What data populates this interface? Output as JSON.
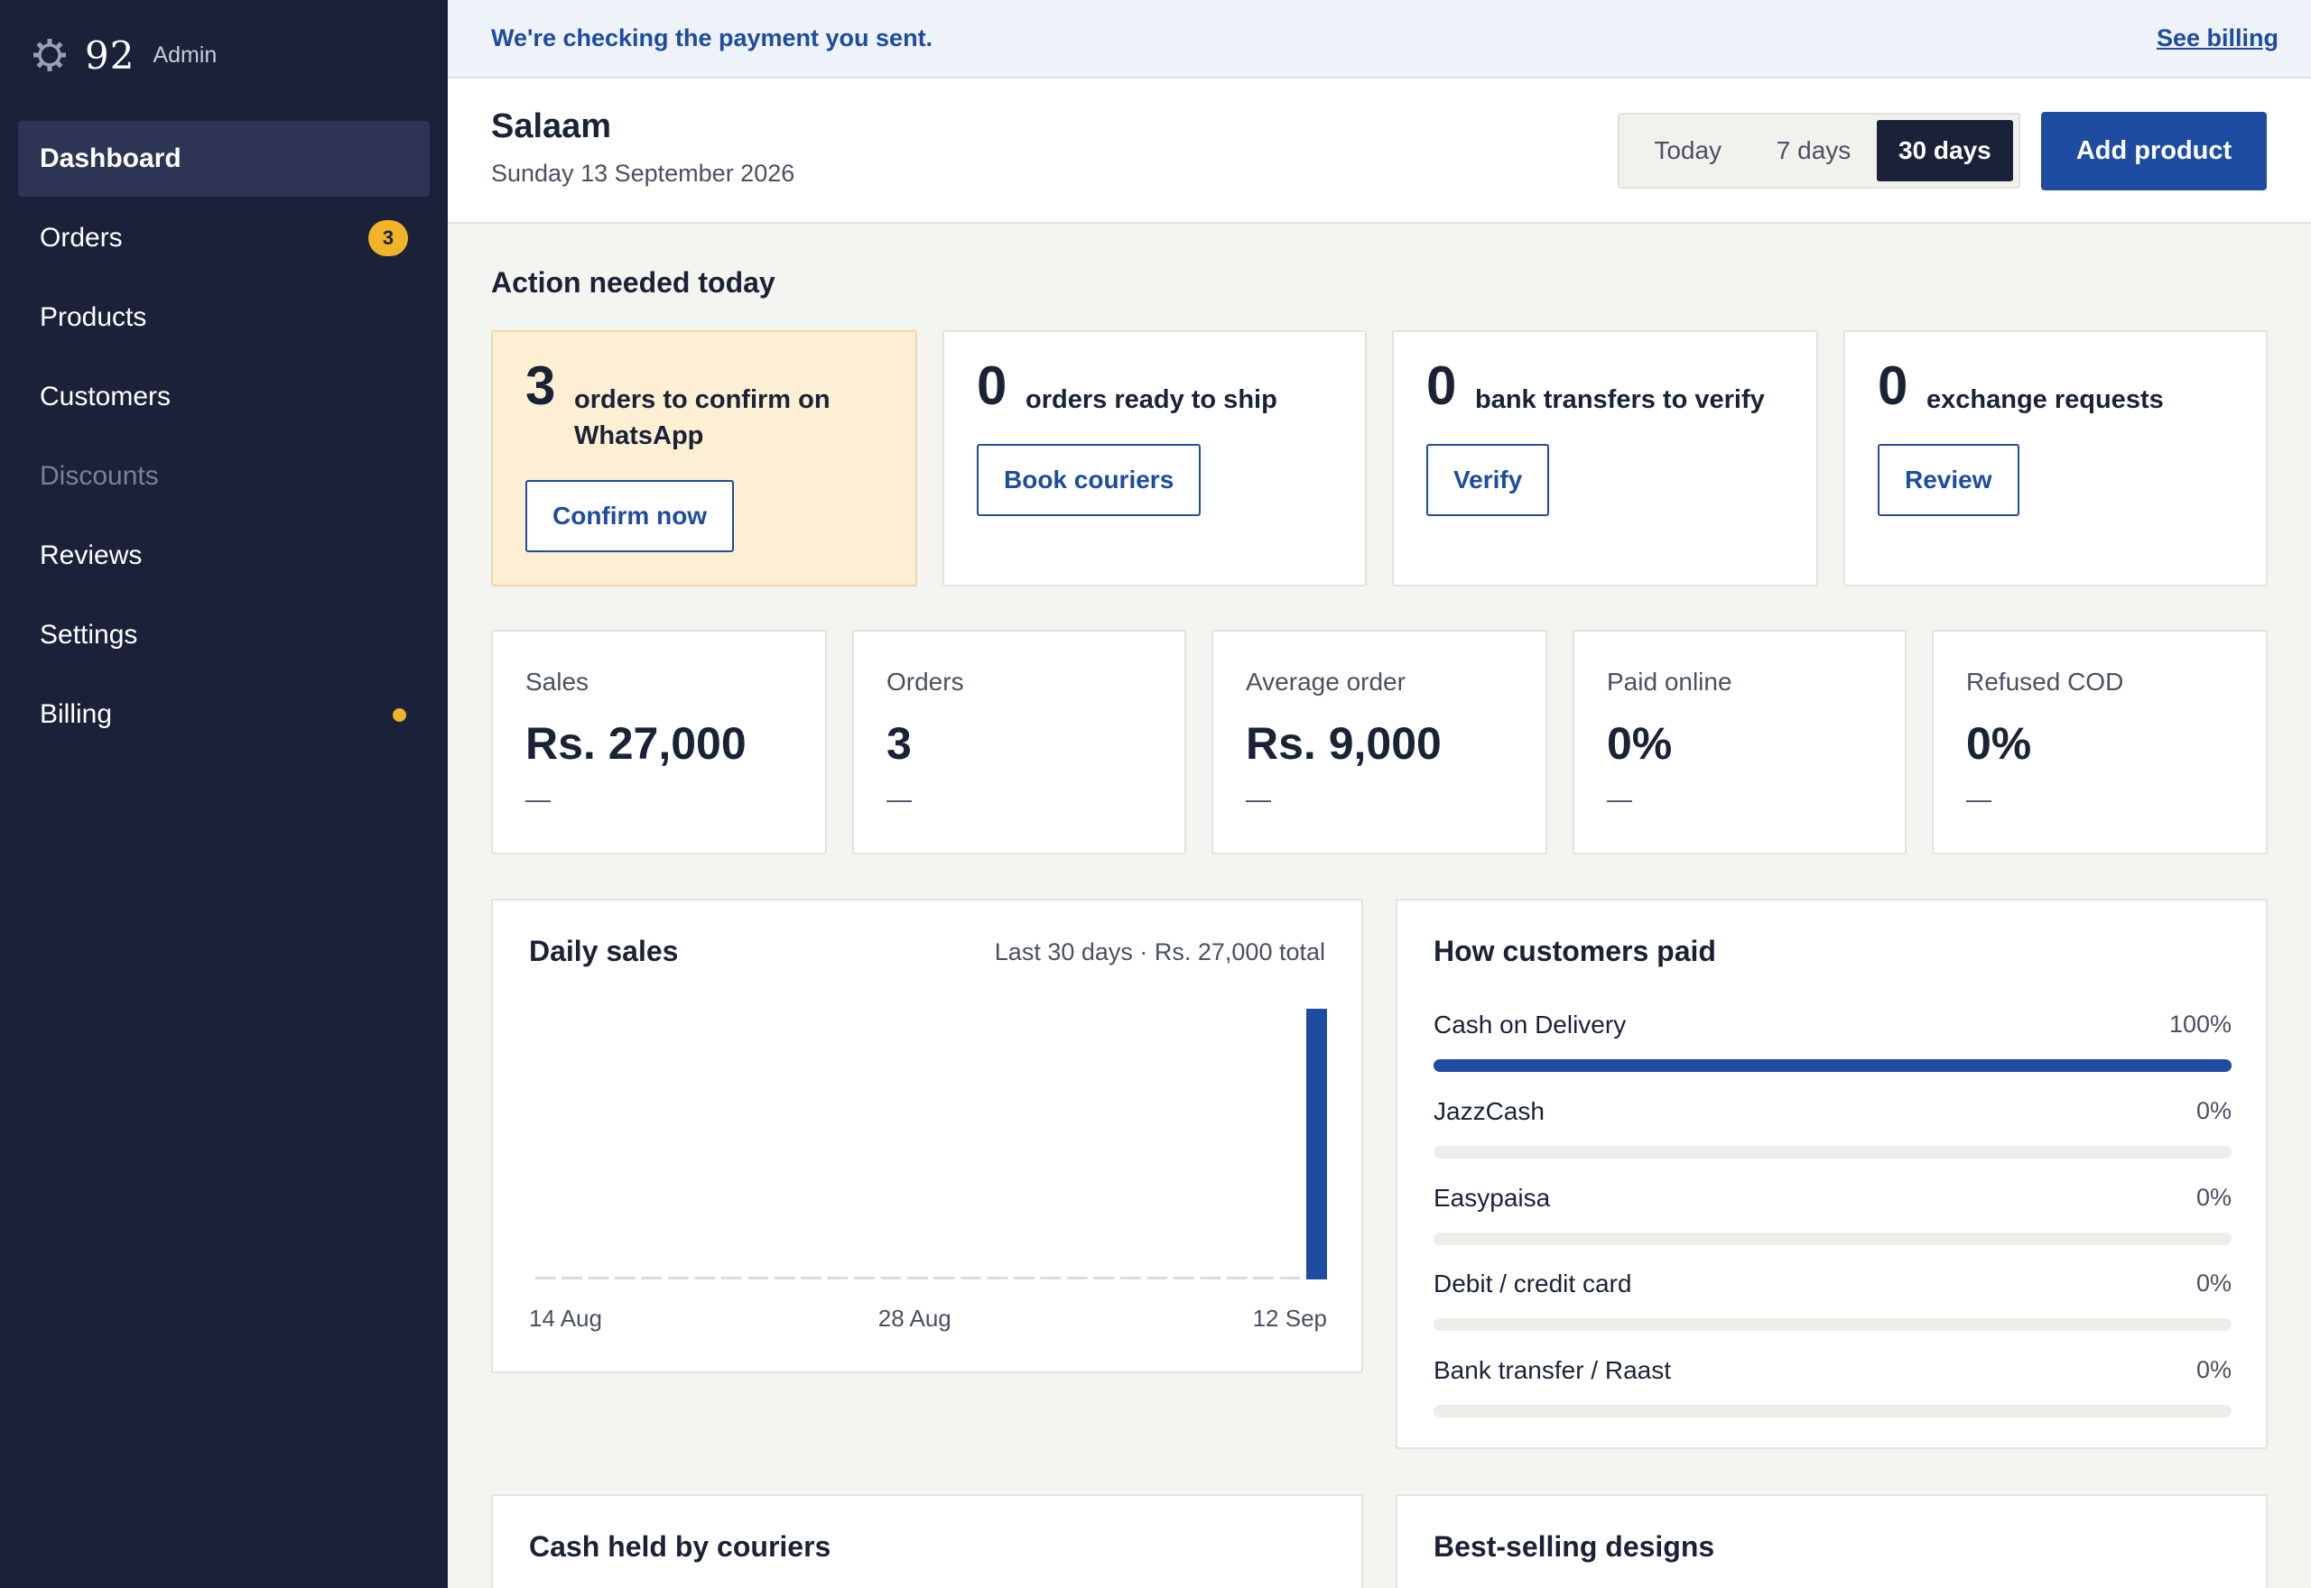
{
  "brand": {
    "logo": "92",
    "admin_label": "Admin"
  },
  "sidebar": {
    "items": [
      {
        "label": "Dashboard",
        "state": "active"
      },
      {
        "label": "Orders",
        "badge": "3"
      },
      {
        "label": "Products"
      },
      {
        "label": "Customers"
      },
      {
        "label": "Discounts",
        "state": "disabled"
      },
      {
        "label": "Reviews"
      },
      {
        "label": "Settings"
      },
      {
        "label": "Billing",
        "dot": true
      }
    ]
  },
  "notice": {
    "message": "We're checking the payment you sent.",
    "link": "See billing"
  },
  "header": {
    "greeting": "Salaam",
    "date": "Sunday 13 September 2026",
    "range": [
      "Today",
      "7 days",
      "30 days"
    ],
    "range_selected": "30 days",
    "add_product": "Add product"
  },
  "action_needed": {
    "title": "Action needed today",
    "cards": [
      {
        "count": "3",
        "text": "orders to confirm on WhatsApp",
        "button": "Confirm now"
      },
      {
        "count": "0",
        "text": "orders ready to ship",
        "button": "Book couriers"
      },
      {
        "count": "0",
        "text": "bank transfers to verify",
        "button": "Verify"
      },
      {
        "count": "0",
        "text": "exchange requests",
        "button": "Review"
      }
    ]
  },
  "stats": [
    {
      "label": "Sales",
      "value": "Rs. 27,000",
      "delta": "—"
    },
    {
      "label": "Orders",
      "value": "3",
      "delta": "—"
    },
    {
      "label": "Average order",
      "value": "Rs. 9,000",
      "delta": "—"
    },
    {
      "label": "Paid online",
      "value": "0%",
      "delta": "—"
    },
    {
      "label": "Refused COD",
      "value": "0%",
      "delta": "—"
    }
  ],
  "daily_sales": {
    "title": "Daily sales",
    "subtitle": "Last 30 days · Rs. 27,000 total",
    "x_tick_labels": [
      "14 Aug",
      "28 Aug",
      "12 Sep"
    ]
  },
  "chart_data": {
    "type": "bar",
    "title": "Daily sales",
    "x_start": "14 Aug",
    "x_end": "12 Sep",
    "values": [
      0,
      0,
      0,
      0,
      0,
      0,
      0,
      0,
      0,
      0,
      0,
      0,
      0,
      0,
      0,
      0,
      0,
      0,
      0,
      0,
      0,
      0,
      0,
      0,
      0,
      0,
      0,
      0,
      0,
      27000
    ],
    "xlabel": "",
    "ylabel": "",
    "grid": false,
    "color": "#1d4ca0"
  },
  "payments": {
    "title": "How customers paid",
    "rows": [
      {
        "name": "Cash on Delivery",
        "value": "100%",
        "fraction": 1.0
      },
      {
        "name": "JazzCash",
        "value": "0%",
        "fraction": 0
      },
      {
        "name": "Easypaisa",
        "value": "0%",
        "fraction": 0
      },
      {
        "name": "Debit / credit card",
        "value": "0%",
        "fraction": 0
      },
      {
        "name": "Bank transfer / Raast",
        "value": "0%",
        "fraction": 0
      }
    ]
  },
  "bottom_panels": {
    "cash_title": "Cash held by couriers",
    "designs_title": "Best-selling designs"
  },
  "colors": {
    "sidebar": "#1b2139",
    "accent": "#1d4ca0",
    "badge": "#f0b429",
    "warning_card": "#fcefd3"
  }
}
